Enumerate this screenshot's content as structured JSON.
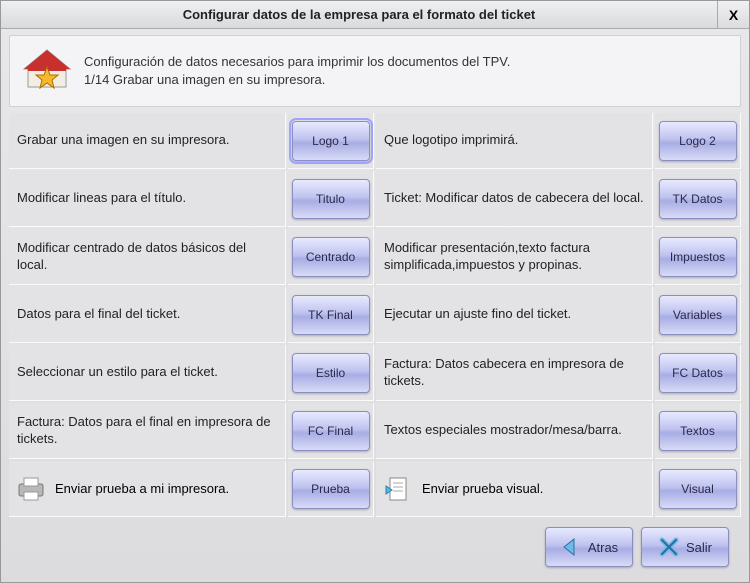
{
  "window": {
    "title": "Configurar datos de la empresa para el formato del ticket",
    "close": "X"
  },
  "description": {
    "line1": "Configuración de datos necesarios para imprimir los documentos del TPV.",
    "line2": "1/14  Grabar una imagen en su impresora."
  },
  "rows": [
    {
      "left_label": "Grabar una imagen en su impresora.",
      "left_button": "Logo 1",
      "right_label": "Que logotipo imprimirá.",
      "right_button": "Logo 2"
    },
    {
      "left_label": "Modificar lineas para el título.",
      "left_button": "Titulo",
      "right_label": "Ticket: Modificar datos de cabecera del local.",
      "right_button": "TK Datos"
    },
    {
      "left_label": "Modificar centrado de datos básicos del local.",
      "left_button": "Centrado",
      "right_label": "Modificar presentación,texto factura simplificada,impuestos y propinas.",
      "right_button": "Impuestos"
    },
    {
      "left_label": "Datos para el final del ticket.",
      "left_button": "TK Final",
      "right_label": "Ejecutar un ajuste fino del ticket.",
      "right_button": "Variables"
    },
    {
      "left_label": "Seleccionar un estilo para el ticket.",
      "left_button": "Estilo",
      "right_label": "Factura: Datos cabecera en impresora de tickets.",
      "right_button": "FC Datos"
    },
    {
      "left_label": "Factura: Datos para el final en impresora de tickets.",
      "left_button": "FC Final",
      "right_label": "Textos especiales mostrador/mesa/barra.",
      "right_button": "Textos"
    }
  ],
  "test_row": {
    "left_label": "Enviar prueba a mi impresora.",
    "left_button": "Prueba",
    "right_label": "Enviar prueba visual.",
    "right_button": "Visual"
  },
  "footer": {
    "back": "Atras",
    "exit": "Salir"
  }
}
